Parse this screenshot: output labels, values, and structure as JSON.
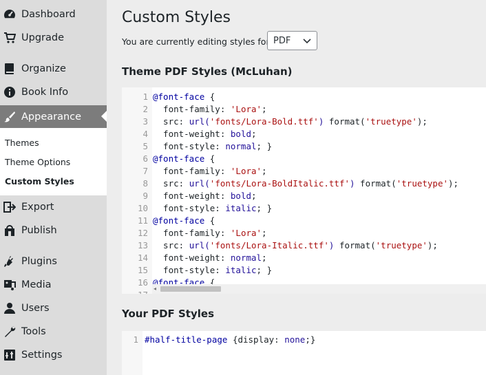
{
  "sidebar": {
    "items": [
      {
        "label": "Dashboard",
        "icon": "dashboard-icon"
      },
      {
        "label": "Upgrade",
        "icon": "cart-icon"
      },
      {
        "label": "Organize",
        "icon": "book-icon"
      },
      {
        "label": "Book Info",
        "icon": "info-icon"
      },
      {
        "label": "Appearance",
        "icon": "paintbrush-icon"
      },
      {
        "label": "Export",
        "icon": "export-icon"
      },
      {
        "label": "Publish",
        "icon": "store-icon"
      },
      {
        "label": "Plugins",
        "icon": "plugin-icon"
      },
      {
        "label": "Media",
        "icon": "media-icon"
      },
      {
        "label": "Users",
        "icon": "user-icon"
      },
      {
        "label": "Tools",
        "icon": "wrench-icon"
      },
      {
        "label": "Settings",
        "icon": "settings-icon"
      }
    ],
    "submenu": [
      {
        "label": "Themes"
      },
      {
        "label": "Theme Options"
      },
      {
        "label": "Custom Styles"
      }
    ]
  },
  "main": {
    "title": "Custom Styles",
    "editing_label": "You are currently editing styles for:",
    "select_value": "PDF",
    "theme_section_title": "Theme PDF Styles (McLuhan)",
    "your_section_title": "Your PDF Styles",
    "theme_code_lines": [
      [
        {
          "t": "kw",
          "v": "@font-face"
        },
        {
          "t": "plain",
          "v": " {"
        }
      ],
      [
        {
          "t": "prop",
          "v": "  font-family: "
        },
        {
          "t": "str",
          "v": "'Lora'"
        },
        {
          "t": "plain",
          "v": ";"
        }
      ],
      [
        {
          "t": "prop",
          "v": "  src: "
        },
        {
          "t": "val",
          "v": "url("
        },
        {
          "t": "str",
          "v": "'fonts/Lora-Bold.ttf'"
        },
        {
          "t": "val",
          "v": ")"
        },
        {
          "t": "plain",
          "v": " format("
        },
        {
          "t": "str",
          "v": "'truetype'"
        },
        {
          "t": "plain",
          "v": ");"
        }
      ],
      [
        {
          "t": "prop",
          "v": "  font-weight: "
        },
        {
          "t": "val",
          "v": "bold"
        },
        {
          "t": "plain",
          "v": ";"
        }
      ],
      [
        {
          "t": "prop",
          "v": "  font-style: "
        },
        {
          "t": "val",
          "v": "normal"
        },
        {
          "t": "plain",
          "v": "; }"
        }
      ],
      [
        {
          "t": "kw",
          "v": "@font-face"
        },
        {
          "t": "plain",
          "v": " {"
        }
      ],
      [
        {
          "t": "prop",
          "v": "  font-family: "
        },
        {
          "t": "str",
          "v": "'Lora'"
        },
        {
          "t": "plain",
          "v": ";"
        }
      ],
      [
        {
          "t": "prop",
          "v": "  src: "
        },
        {
          "t": "val",
          "v": "url("
        },
        {
          "t": "str",
          "v": "'fonts/Lora-BoldItalic.ttf'"
        },
        {
          "t": "val",
          "v": ")"
        },
        {
          "t": "plain",
          "v": " format("
        },
        {
          "t": "str",
          "v": "'truetype'"
        },
        {
          "t": "plain",
          "v": ");"
        }
      ],
      [
        {
          "t": "prop",
          "v": "  font-weight: "
        },
        {
          "t": "val",
          "v": "bold"
        },
        {
          "t": "plain",
          "v": ";"
        }
      ],
      [
        {
          "t": "prop",
          "v": "  font-style: "
        },
        {
          "t": "val",
          "v": "italic"
        },
        {
          "t": "plain",
          "v": "; }"
        }
      ],
      [
        {
          "t": "kw",
          "v": "@font-face"
        },
        {
          "t": "plain",
          "v": " {"
        }
      ],
      [
        {
          "t": "prop",
          "v": "  font-family: "
        },
        {
          "t": "str",
          "v": "'Lora'"
        },
        {
          "t": "plain",
          "v": ";"
        }
      ],
      [
        {
          "t": "prop",
          "v": "  src: "
        },
        {
          "t": "val",
          "v": "url("
        },
        {
          "t": "str",
          "v": "'fonts/Lora-Italic.ttf'"
        },
        {
          "t": "val",
          "v": ")"
        },
        {
          "t": "plain",
          "v": " format("
        },
        {
          "t": "str",
          "v": "'truetype'"
        },
        {
          "t": "plain",
          "v": ");"
        }
      ],
      [
        {
          "t": "prop",
          "v": "  font-weight: "
        },
        {
          "t": "val",
          "v": "normal"
        },
        {
          "t": "plain",
          "v": ";"
        }
      ],
      [
        {
          "t": "prop",
          "v": "  font-style: "
        },
        {
          "t": "val",
          "v": "italic"
        },
        {
          "t": "plain",
          "v": "; }"
        }
      ],
      [
        {
          "t": "kw",
          "v": "@font-face"
        },
        {
          "t": "plain",
          "v": " {"
        }
      ],
      [
        {
          "t": "plain",
          "v": ""
        }
      ]
    ],
    "your_code_lines": [
      [
        {
          "t": "kw",
          "v": "#half-title-page"
        },
        {
          "t": "plain",
          "v": " {display: "
        },
        {
          "t": "val",
          "v": "none"
        },
        {
          "t": "plain",
          "v": ";}"
        }
      ]
    ]
  }
}
